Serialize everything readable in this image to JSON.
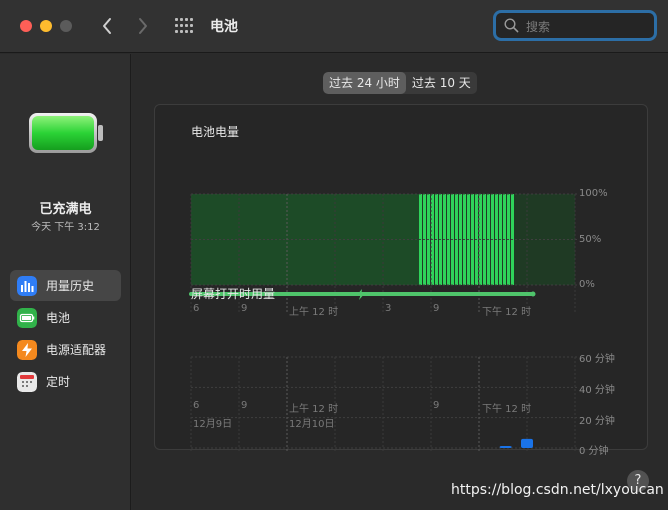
{
  "window": {
    "title": "电池",
    "search_placeholder": "搜索"
  },
  "sidebar": {
    "status_title": "已充满电",
    "status_time": "今天 下午 3:12",
    "items": [
      {
        "label": "用量历史",
        "icon": "chart-bars-icon",
        "color": "#2f7df6",
        "active": true
      },
      {
        "label": "电池",
        "icon": "battery-icon",
        "color": "#31b24a",
        "active": false
      },
      {
        "label": "电源适配器",
        "icon": "bolt-icon",
        "color": "#f4891e",
        "active": false
      },
      {
        "label": "定时",
        "icon": "calendar-icon",
        "color": "#e9e9e9",
        "active": false
      }
    ]
  },
  "segment": {
    "options": [
      "过去 24 小时",
      "过去 10 天"
    ],
    "selected": 0
  },
  "charts": [
    {
      "title": "电池电量",
      "type": "bar",
      "ylabels": [
        "100%",
        "50%",
        "0%"
      ],
      "xlabels": [
        "6",
        "9",
        "上午 12 时",
        "3",
        "6",
        "9",
        "下午 12 时",
        "3"
      ],
      "accent": "#30d158"
    },
    {
      "title": "屏幕打开时用量",
      "type": "bar",
      "ylabels": [
        "60 分钟",
        "40 分钟",
        "20 分钟",
        "0 分钟"
      ],
      "xlabels": [
        "6",
        "9",
        "上午 12 时",
        "3",
        "6",
        "9",
        "下午 12 时",
        "3"
      ],
      "date_labels": [
        "12月9日",
        "12月10日"
      ],
      "accent": "#1a73e8"
    }
  ],
  "chart_data": [
    {
      "type": "bar",
      "title": "电池电量",
      "ylim": [
        0,
        100
      ],
      "x": [
        "6",
        "9",
        "上午 12 时",
        "3",
        "6",
        "9",
        "下午 12 时",
        "3"
      ],
      "levels": [
        {
          "x_range": [
            "18:00",
            "08:15"
          ],
          "value": 100,
          "state": "dim"
        },
        {
          "x_range": [
            "08:15",
            "14:15"
          ],
          "value": 100,
          "state": "charging"
        }
      ],
      "grid": true
    },
    {
      "type": "bar",
      "title": "屏幕打开时用量",
      "ylim": [
        0,
        60
      ],
      "x": [
        "6",
        "9",
        "上午 12 时",
        "3",
        "6",
        "9",
        "下午 12 时",
        "3"
      ],
      "values": [
        {
          "x": "13:40",
          "value": 1
        },
        {
          "x": "15:00",
          "value": 6
        }
      ],
      "grid": true
    }
  ],
  "help": "?",
  "watermark": "https://blog.csdn.net/lxyoucan"
}
